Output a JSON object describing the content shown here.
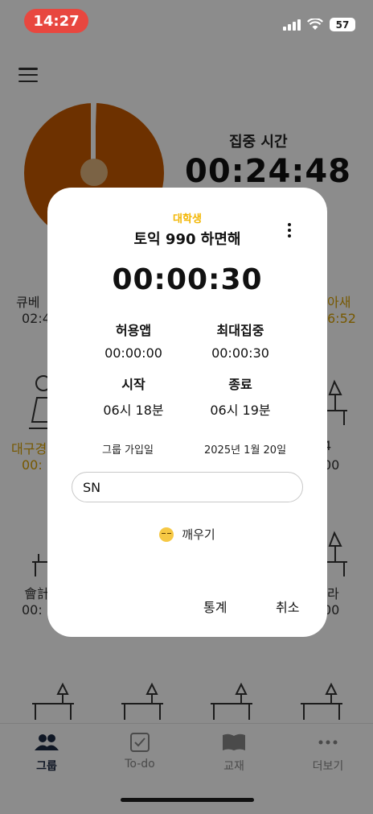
{
  "status_bar": {
    "time": "14:27",
    "battery": "57"
  },
  "focus": {
    "label": "집중 시간",
    "time": "00:24:48"
  },
  "members": [
    {
      "name": "큐베",
      "time": "02:4"
    },
    {
      "name": "아새",
      "time": "6:52"
    },
    {
      "name": "대구경",
      "time": "00:"
    },
    {
      "name": "4",
      "time": "00"
    },
    {
      "name": "會計",
      "time": "00:"
    },
    {
      "name": "라",
      "time": "00"
    }
  ],
  "dialog": {
    "category": "대학생",
    "title": "토익 990 하면해",
    "timer": "00:00:30",
    "stats": [
      {
        "key": "허용앱",
        "value": "00:00:00"
      },
      {
        "key": "최대집중",
        "value": "00:00:30"
      },
      {
        "key": "시작",
        "value": "06시 18분"
      },
      {
        "key": "종료",
        "value": "06시 19분"
      }
    ],
    "join_label": "그룹 가입일",
    "join_date": "2025년 1월 20일",
    "memo": "SN",
    "wake_label": "깨우기",
    "stats_button": "통계",
    "cancel_button": "취소"
  },
  "bottom_nav": [
    {
      "label": "그룹",
      "icon": "group-icon"
    },
    {
      "label": "To-do",
      "icon": "checkbox-icon"
    },
    {
      "label": "교재",
      "icon": "book-icon"
    },
    {
      "label": "더보기",
      "icon": "more-icon"
    }
  ],
  "colors": {
    "accent": "#f2b500",
    "timer_fill": "#c65a00",
    "status_red": "#e8473f"
  }
}
